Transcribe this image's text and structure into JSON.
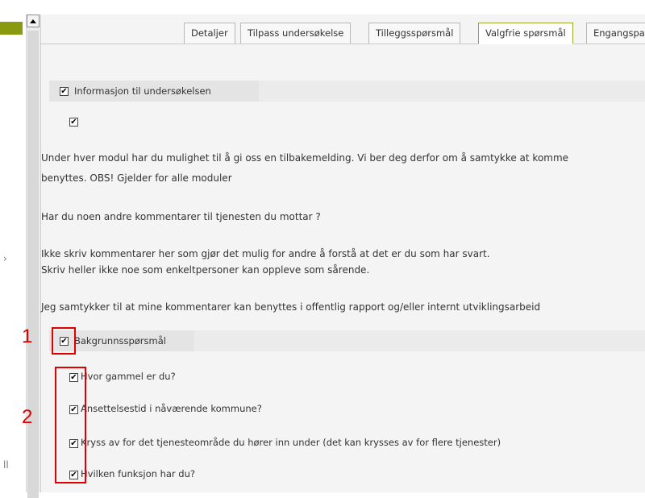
{
  "left_panel": {
    "glyph_a": "›",
    "glyph_b": "ll"
  },
  "tabs": [
    {
      "label": "Detaljer",
      "active": false
    },
    {
      "label": "Tilpass undersøkelse",
      "active": false
    },
    {
      "label": "Tilleggsspørsmål",
      "active": false
    },
    {
      "label": "Valgfrie spørsmål",
      "active": true
    },
    {
      "label": "Engangspa",
      "active": false
    }
  ],
  "section_info": {
    "title": "Informasjon til undersøkelsen",
    "checked": true,
    "paragraph1_line1": "Under hver modul har du mulighet til å gi oss en tilbakemelding. Vi ber deg derfor om å samtykke at komme",
    "paragraph1_line2": "benyttes. OBS! Gjelder for alle moduler",
    "paragraph2": "Har du noen andre kommentarer til tjenesten du mottar ?",
    "paragraph3_line1": "Ikke skriv kommentarer her som gjør det mulig for andre å forstå at det er du som har svart.",
    "paragraph3_line2": "Skriv heller ikke noe som enkeltpersoner kan oppleve som sårende.",
    "paragraph4": "Jeg samtykker til at mine kommentarer kan benyttes i offentlig rapport og/eller internt utviklingsarbeid"
  },
  "section_background": {
    "title": "Bakgrunnsspørsmål",
    "checked": true,
    "questions": [
      "Hvor gammel er du?",
      "Ansettelsestid i nåværende kommune?",
      "Kryss av for det tjenesteområde du hører inn under (det kan krysses av for flere tjenester)",
      "Hvilken funksjon har du?"
    ]
  },
  "annotations": {
    "marker1": "1",
    "marker2": "2",
    "color": "#e00000"
  },
  "colors": {
    "accent": "#8a9a10",
    "active_tab_border": "#9aa82a"
  },
  "checkmark": "✔"
}
